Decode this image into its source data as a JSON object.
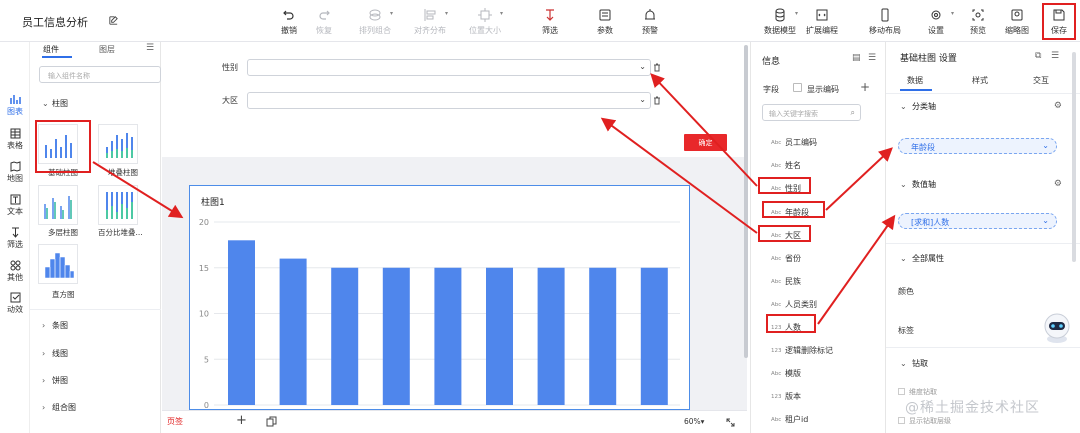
{
  "app": {
    "title": "员工信息分析"
  },
  "toolbar": {
    "undo": "撤销",
    "redo": "恢复",
    "arrange": "排列组合",
    "align": "对齐分布",
    "position": "位置大小",
    "filter": "筛选",
    "params": "参数",
    "alert": "预警",
    "datamodel": "数据模型",
    "extend": "扩展编程",
    "mobile": "移动布局",
    "settings": "设置",
    "preview": "预览",
    "thumb": "缩略图",
    "save": "保存"
  },
  "rail": {
    "chart": "图表",
    "table": "表格",
    "map": "地图",
    "text": "文本",
    "filter": "筛选",
    "other": "其他",
    "effect": "动效"
  },
  "components": {
    "tab_components": "组件",
    "tab_layers": "图层",
    "search_placeholder": "输入组件名称",
    "category_bar": "柱图",
    "items": [
      "基础柱图",
      "堆叠柱图",
      "多层柱图",
      "百分比堆叠...",
      "直方图"
    ],
    "categories": [
      "条图",
      "线图",
      "饼图",
      "组合图"
    ]
  },
  "filters": {
    "gender": "性别",
    "region": "大区"
  },
  "chart_card": {
    "title": "柱图1"
  },
  "chart_data": {
    "type": "bar",
    "title": "柱图1",
    "ylim": [
      0,
      20
    ],
    "yticks": [
      0,
      5,
      10,
      15,
      20
    ],
    "values": [
      18,
      16,
      15,
      15,
      15,
      15,
      15,
      15,
      15
    ]
  },
  "footer": {
    "page": "页签",
    "zoom": "60%"
  },
  "info": {
    "title": "信息",
    "field_label": "字段",
    "show_code": "显示编码",
    "search_placeholder": "输入关键字搜索",
    "fields": [
      {
        "type": "Abc",
        "name": "员工编码"
      },
      {
        "type": "Abc",
        "name": "姓名"
      },
      {
        "type": "Abc",
        "name": "性别"
      },
      {
        "type": "Abc",
        "name": "年龄段"
      },
      {
        "type": "Abc",
        "name": "大区"
      },
      {
        "type": "Abc",
        "name": "省份"
      },
      {
        "type": "Abc",
        "name": "民族"
      },
      {
        "type": "Abc",
        "name": "人员类别"
      },
      {
        "type": "123",
        "name": "人数"
      },
      {
        "type": "123",
        "name": "逻辑删除标记"
      },
      {
        "type": "Abc",
        "name": "模版"
      },
      {
        "type": "123",
        "name": "版本"
      },
      {
        "type": "Abc",
        "name": "租户id"
      }
    ]
  },
  "confirm_label": "确定",
  "settings": {
    "title": "基础柱图 设置",
    "tabs": [
      "数据",
      "样式",
      "交互"
    ],
    "category_axis": "分类轴",
    "category_value": "年龄段",
    "value_axis": "数值轴",
    "value_value": "[求和]人数",
    "all_props": "全部属性",
    "color": "颜色",
    "label": "标签",
    "drill": "钻取",
    "drill_opt1": "维度钻取",
    "drill_opt2": "显示钻取层级"
  },
  "watermark": "@稀土掘金技术社区",
  "colors": {
    "accent": "#2f6fe8",
    "bar": "#4f86ec",
    "annotation": "#e02020"
  }
}
